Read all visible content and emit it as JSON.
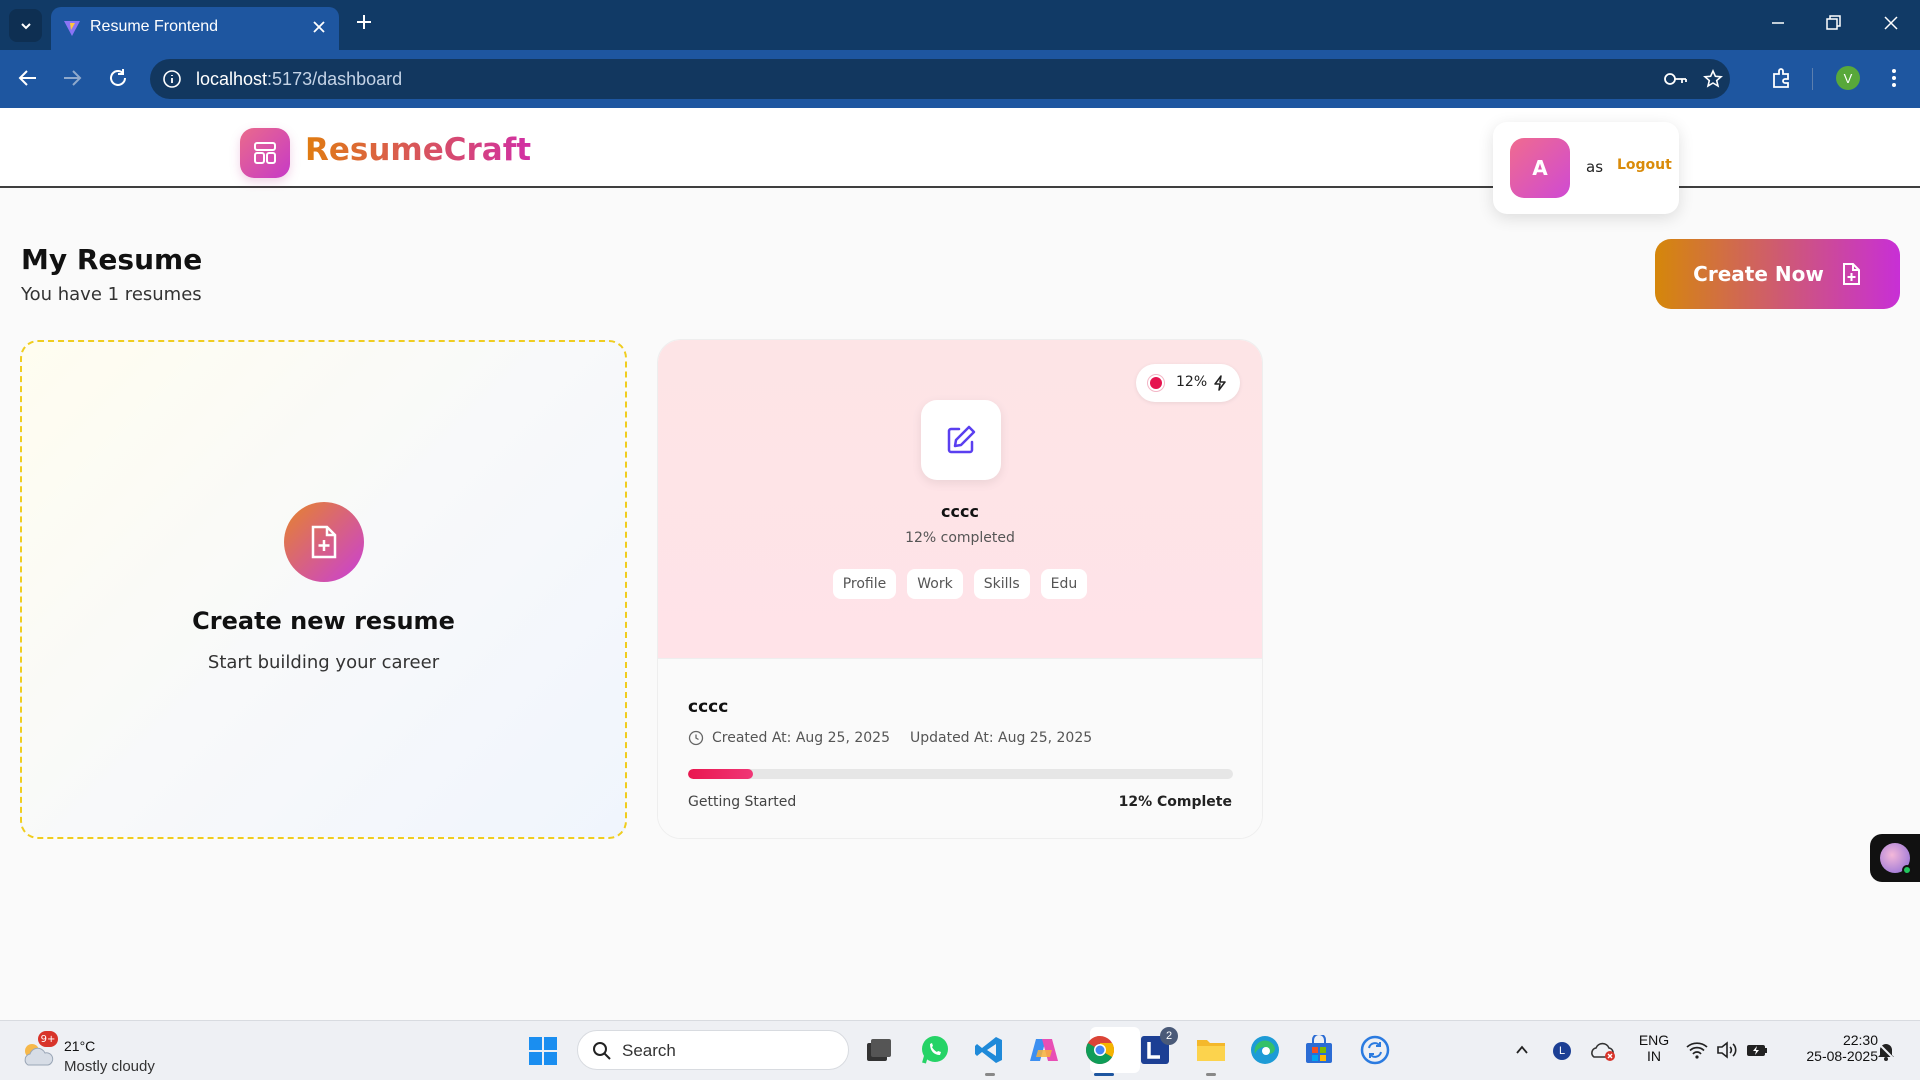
{
  "browser": {
    "tab_title": "Resume Frontend",
    "url_host": "localhost",
    "url_path": ":5173/dashboard"
  },
  "header": {
    "logo_text": "ResumeCraft",
    "user": {
      "avatar_initial": "A",
      "name": "as",
      "logout_label": "Logout"
    }
  },
  "page": {
    "title": "My Resume",
    "subtitle": "You have 1 resumes",
    "create_now_label": "Create Now"
  },
  "new_resume_card": {
    "title": "Create new resume",
    "subtitle": "Start building your career"
  },
  "resume_cards": [
    {
      "name": "cccc",
      "progress_badge": "12%",
      "completed_text": "12% completed",
      "sections": [
        "Profile",
        "Work",
        "Skills",
        "Edu"
      ],
      "title": "cccc",
      "created_at": "Created At: Aug 25, 2025",
      "updated_at": "Updated At: Aug 25, 2025",
      "progress_percent": 12,
      "status": "Getting Started",
      "complete_text": "12% Complete"
    }
  ],
  "taskbar": {
    "weather_badge": "9+",
    "weather_temp": "21°C",
    "weather_desc": "Mostly cloudy",
    "search_label": "Search",
    "language_line1": "ENG",
    "language_line2": "IN",
    "time": "22:30",
    "date": "25-08-2025",
    "notification_count": "2",
    "profile_letter": "V"
  },
  "colors": {
    "accent_orange": "#d5870a",
    "accent_magenta": "#c82fd6",
    "progress_red": "#e9174f",
    "dashed_border": "#f0cd1f"
  }
}
